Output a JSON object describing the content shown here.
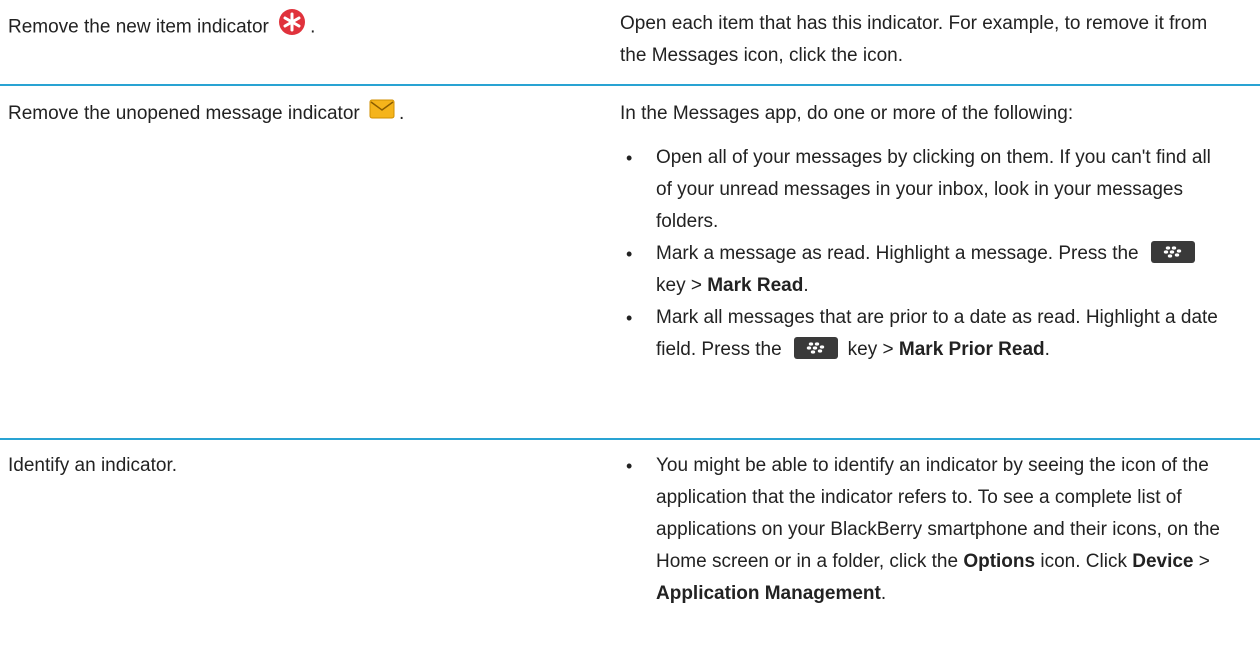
{
  "rows": [
    {
      "action_text": "Remove the new item indicator",
      "action_suffix": ".",
      "icon": "new-item-indicator-icon",
      "description": "Open each item that has this indicator. For example, to remove it from the Messages icon, click the icon."
    },
    {
      "action_text": "Remove the unopened message indicator",
      "action_suffix": ".",
      "icon": "unopened-message-indicator-icon",
      "intro": "In the Messages app, do one or more of the following:",
      "bullets": [
        {
          "text": "Open all of your messages by clicking on them. If you can't find all of your unread messages in your inbox, look in your messages folders."
        },
        {
          "pre": "Mark a message as read. Highlight a message. Press the",
          "key_suffix": "key >",
          "bold": "Mark Read",
          "post": "."
        },
        {
          "pre": "Mark all messages that are prior to a date as read. Highlight a date field. Press the",
          "key_suffix": "key >",
          "bold": "Mark Prior Read",
          "post": "."
        }
      ]
    },
    {
      "action_text": "Identify an indicator.",
      "bullet": {
        "pre": "You might be able to identify an indicator by seeing the icon of the application that the indicator refers to. To see a complete list of applications on your BlackBerry smartphone and their icons, on the Home screen or in a folder, click the",
        "bold1": "Options",
        "mid1": "icon. Click",
        "bold2": "Device",
        "mid2": ">",
        "bold3": "Application Management",
        "post": "."
      }
    }
  ],
  "colors": {
    "divider": "#29a3d3",
    "new_item_indicator": "#e0323c",
    "envelope": "#f5b41b",
    "menu_key": "#3a3a3a"
  },
  "menu_key_icon": "blackberry-menu-key-icon"
}
